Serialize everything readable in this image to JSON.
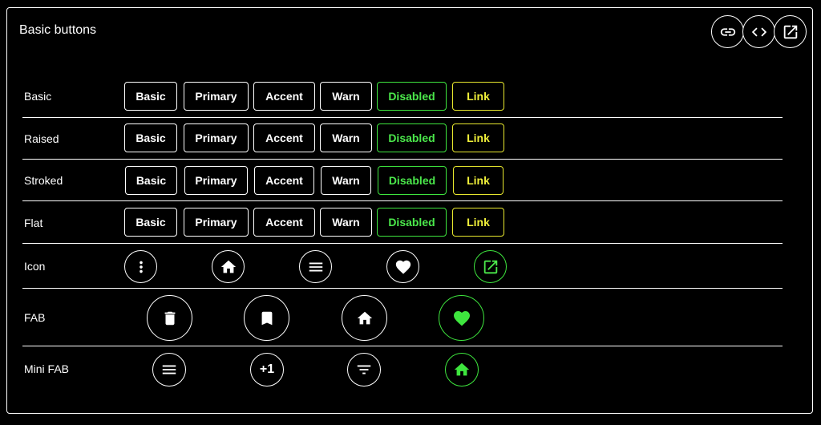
{
  "card": {
    "title": "Basic buttons"
  },
  "header_actions": [
    {
      "icon": "link-icon"
    },
    {
      "icon": "code-icon"
    },
    {
      "icon": "open-in-new-icon"
    }
  ],
  "rows": {
    "basic": {
      "label": "Basic"
    },
    "raised": {
      "label": "Raised"
    },
    "stroked": {
      "label": "Stroked"
    },
    "flat": {
      "label": "Flat"
    },
    "icon": {
      "label": "Icon"
    },
    "fab": {
      "label": "FAB"
    },
    "minifab": {
      "label": "Mini FAB"
    }
  },
  "button_labels": [
    "Basic",
    "Primary",
    "Accent",
    "Warn",
    "Disabled",
    "Link"
  ],
  "icon_buttons": [
    "more-vert-icon",
    "home-icon",
    "menu-icon",
    "favorite-icon",
    "open-in-new-icon"
  ],
  "fab_buttons": [
    "delete-icon",
    "bookmark-icon",
    "home-icon",
    "favorite-icon"
  ],
  "mini_fab_buttons": [
    "menu-icon",
    "plus-one-icon",
    "filter-list-icon",
    "home-icon"
  ],
  "mini_fab_plus_one_text": "+1",
  "colors": {
    "disabled": "#3ee63e",
    "link": "#e8e82e",
    "border": "#ffffff",
    "background": "#000000"
  }
}
